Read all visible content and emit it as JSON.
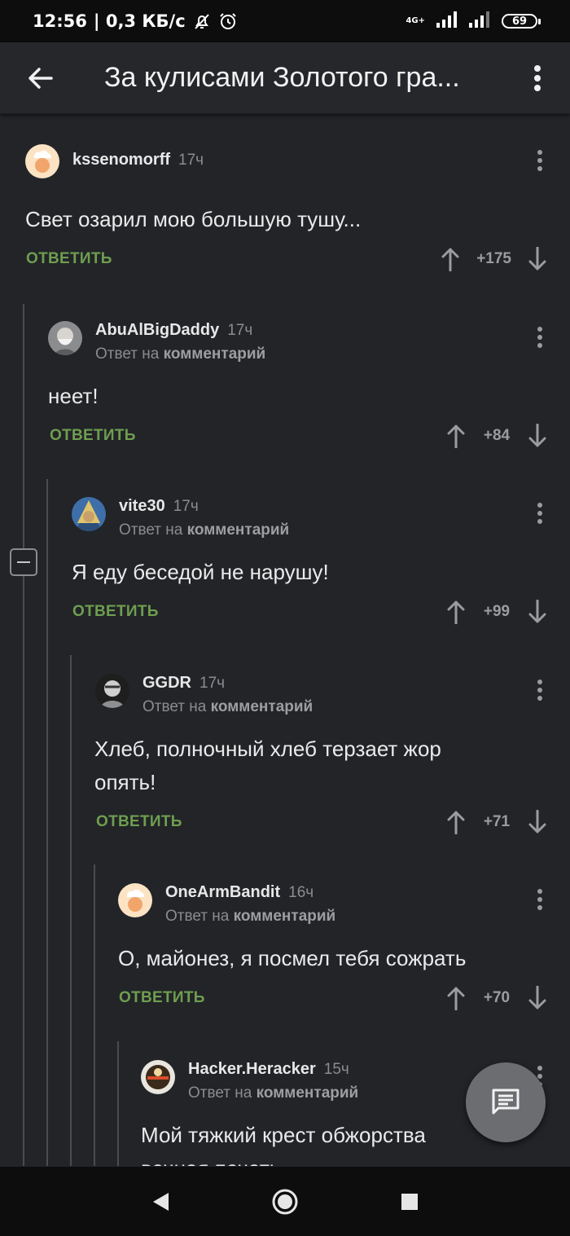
{
  "status_bar": {
    "time": "12:56",
    "speed": "| 0,3 КБ/с",
    "network": "4G+",
    "battery": "69"
  },
  "app_bar": {
    "title": "За кулисами Золотого гра..."
  },
  "comments": [
    {
      "author": "kssenomorff",
      "time": "17ч",
      "reply_to_prefix": "",
      "reply_to_link": "",
      "text": "Свет озарил мою большую тушу...",
      "reply_label": "ОТВЕТИТЬ",
      "score": "+175",
      "avatar": "chef-avatar"
    },
    {
      "author": "AbuAlBigDaddy",
      "time": "17ч",
      "reply_to_prefix": "Ответ на",
      "reply_to_link": "комментарий",
      "text": "неет!",
      "reply_label": "ОТВЕТИТЬ",
      "score": "+84",
      "avatar": "photo-avatar"
    },
    {
      "author": "vite30",
      "time": "17ч",
      "reply_to_prefix": "Ответ на",
      "reply_to_link": "комментарий",
      "text": "Я еду беседой не нарушу!",
      "reply_label": "ОТВЕТИТЬ",
      "score": "+99",
      "avatar": "portrait-avatar"
    },
    {
      "author": "GGDR",
      "time": "17ч",
      "reply_to_prefix": "Ответ на",
      "reply_to_link": "комментарий",
      "text": "Хлеб, полночный хлеб терзает жор опять!",
      "reply_label": "ОТВЕТИТЬ",
      "score": "+71",
      "avatar": "bw-avatar"
    },
    {
      "author": "OneArmBandit",
      "time": "16ч",
      "reply_to_prefix": "Ответ на",
      "reply_to_link": "комментарий",
      "text": "О, майонез, я посмел тебя сожрать",
      "reply_label": "ОТВЕТИТЬ",
      "score": "+70",
      "avatar": "chef-avatar"
    },
    {
      "author": "Hacker.Heracker",
      "time": "15ч",
      "reply_to_prefix": "Ответ на",
      "reply_to_link": "комментарий",
      "text": "Мой тяжкий крест обжорства вечная печать",
      "reply_label": "",
      "score": "",
      "avatar": "badge-avatar"
    }
  ],
  "colors": {
    "background": "#222428",
    "accent_reply": "#6f9e4f",
    "fab": "#6b6d70"
  },
  "icons": {
    "back": "arrow-left-icon",
    "more": "more-vertical-icon",
    "upvote": "arrow-up-icon",
    "downvote": "arrow-down-icon",
    "fab": "comment-icon",
    "collapse": "minus-box-icon"
  }
}
